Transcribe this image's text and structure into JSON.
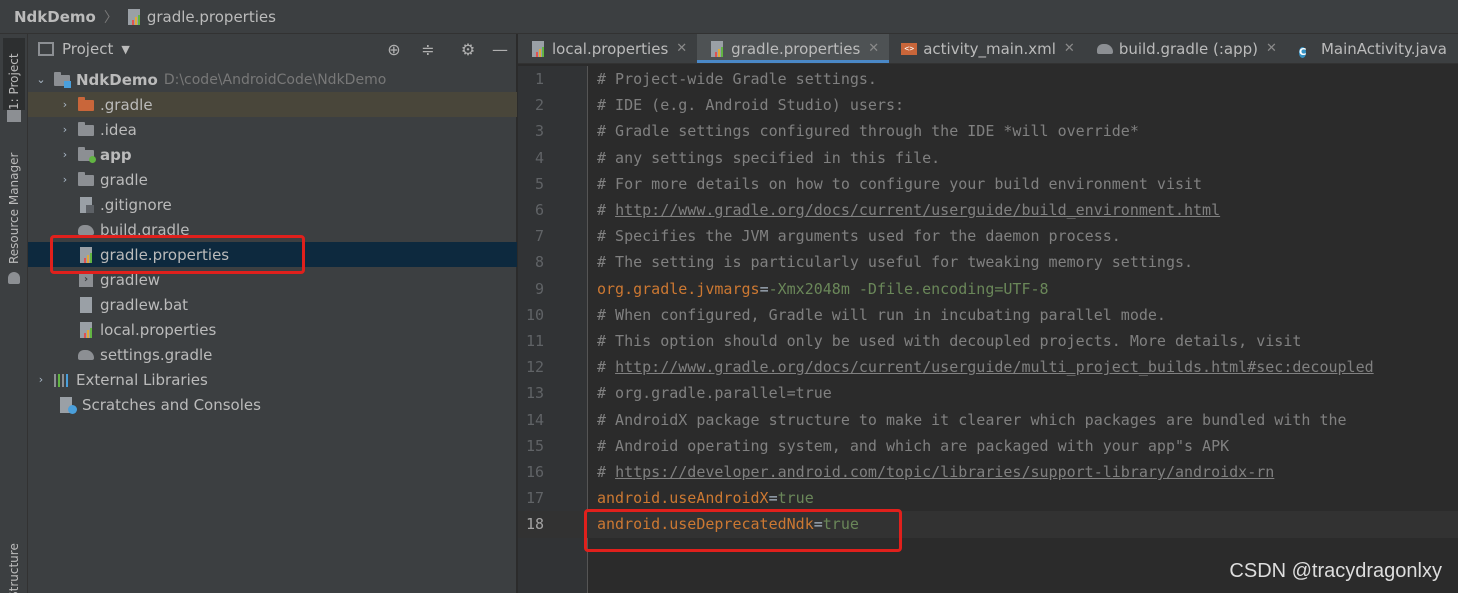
{
  "breadcrumb": {
    "project": "NdkDemo",
    "file": "gradle.properties"
  },
  "tool_stripe": {
    "project_tab": "1: Project",
    "resource_manager_tab": "Resource Manager",
    "structure_tab": "Structure"
  },
  "project_panel": {
    "title": "Project",
    "tree": [
      {
        "label": "NdkDemo",
        "path": "D:\\code\\AndroidCode\\NdkDemo",
        "icon": "module-folder-icon",
        "expanded": true
      },
      {
        "label": ".gradle",
        "icon": "folder-orange-icon"
      },
      {
        "label": ".idea",
        "icon": "folder-icon"
      },
      {
        "label": "app",
        "icon": "app-module-folder-icon"
      },
      {
        "label": "gradle",
        "icon": "folder-icon"
      },
      {
        "label": ".gitignore",
        "icon": "gitignore-file-icon"
      },
      {
        "label": "build.gradle",
        "icon": "gradle-file-icon"
      },
      {
        "label": "gradle.properties",
        "icon": "properties-file-icon",
        "selected": true
      },
      {
        "label": "gradlew",
        "icon": "script-file-icon"
      },
      {
        "label": "gradlew.bat",
        "icon": "text-file-icon"
      },
      {
        "label": "local.properties",
        "icon": "properties-file-icon"
      },
      {
        "label": "settings.gradle",
        "icon": "gradle-file-icon"
      },
      {
        "label": "External Libraries",
        "icon": "libraries-icon"
      },
      {
        "label": "Scratches and Consoles",
        "icon": "scratches-icon"
      }
    ]
  },
  "editor": {
    "tabs": [
      {
        "label": "local.properties",
        "icon": "properties-file-icon",
        "active": false
      },
      {
        "label": "gradle.properties",
        "icon": "properties-file-icon",
        "active": true
      },
      {
        "label": "activity_main.xml",
        "icon": "xml-file-icon",
        "active": false
      },
      {
        "label": "build.gradle (:app)",
        "icon": "gradle-file-icon",
        "active": false
      },
      {
        "label": "MainActivity.java",
        "icon": "java-class-icon",
        "active": false
      }
    ],
    "lines": [
      {
        "n": "1",
        "type": "comment",
        "text": "# Project-wide Gradle settings."
      },
      {
        "n": "2",
        "type": "comment",
        "text": "# IDE (e.g. Android Studio) users:"
      },
      {
        "n": "3",
        "type": "comment",
        "text": "# Gradle settings configured through the IDE *will override*"
      },
      {
        "n": "4",
        "type": "comment",
        "text": "# any settings specified in this file."
      },
      {
        "n": "5",
        "type": "comment",
        "text": "# For more details on how to configure your build environment visit"
      },
      {
        "n": "6",
        "type": "link",
        "prefix": "# ",
        "text": "http://www.gradle.org/docs/current/userguide/build_environment.html"
      },
      {
        "n": "7",
        "type": "comment",
        "text": "# Specifies the JVM arguments used for the daemon process."
      },
      {
        "n": "8",
        "type": "comment",
        "text": "# The setting is particularly useful for tweaking memory settings."
      },
      {
        "n": "9",
        "type": "prop",
        "key": "org.gradle.jvmargs",
        "value": "-Xmx2048m -Dfile.encoding=UTF-8"
      },
      {
        "n": "10",
        "type": "comment",
        "text": "# When configured, Gradle will run in incubating parallel mode."
      },
      {
        "n": "11",
        "type": "comment",
        "text": "# This option should only be used with decoupled projects. More details, visit"
      },
      {
        "n": "12",
        "type": "link",
        "prefix": "# ",
        "text": "http://www.gradle.org/docs/current/userguide/multi_project_builds.html#sec:decoupled"
      },
      {
        "n": "13",
        "type": "comment",
        "text": "# org.gradle.parallel=true"
      },
      {
        "n": "14",
        "type": "comment",
        "text": "# AndroidX package structure to make it clearer which packages are bundled with the"
      },
      {
        "n": "15",
        "type": "comment",
        "text": "# Android operating system, and which are packaged with your app\"s APK"
      },
      {
        "n": "16",
        "type": "link",
        "prefix": "# ",
        "text": "https://developer.android.com/topic/libraries/support-library/androidx-rn"
      },
      {
        "n": "17",
        "type": "prop",
        "key": "android.useAndroidX",
        "value": "true"
      },
      {
        "n": "18",
        "type": "prop",
        "key": "android.useDeprecatedNdk",
        "value": "true",
        "current": true
      }
    ]
  },
  "watermark": "CSDN @tracydragonlxy",
  "colors": {
    "highlight": "#e0201c",
    "selection": "#0d293e",
    "keyword": "#cc7832",
    "string": "#6a8759",
    "comment": "#808080"
  }
}
